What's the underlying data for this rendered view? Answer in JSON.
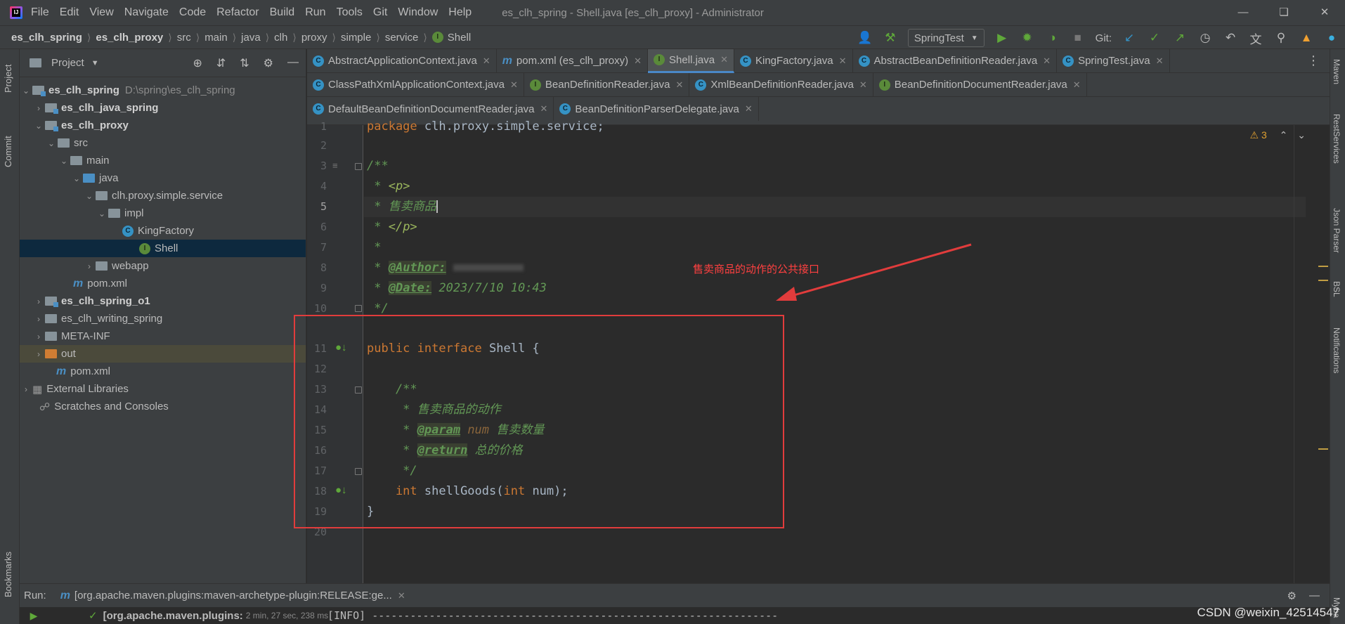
{
  "menubar": {
    "items": [
      "File",
      "Edit",
      "View",
      "Navigate",
      "Code",
      "Refactor",
      "Build",
      "Run",
      "Tools",
      "Git",
      "Window",
      "Help"
    ],
    "title": "es_clh_spring - Shell.java [es_clh_proxy] - Administrator"
  },
  "breadcrumb": [
    "es_clh_spring",
    "es_clh_proxy",
    "src",
    "main",
    "java",
    "clh",
    "proxy",
    "simple",
    "service",
    "Shell"
  ],
  "toolbar": {
    "run_config": "SpringTest",
    "git_label": "Git:"
  },
  "stripes": {
    "left": [
      "Project",
      "Commit",
      "Bookmarks"
    ],
    "right": [
      "Maven",
      "RestServices",
      "Json Parser",
      "BSL",
      "Notifications",
      "Myba"
    ]
  },
  "project": {
    "title": "Project",
    "tree": [
      {
        "label": "es_clh_spring",
        "extra": "D:\\spring\\es_clh_spring",
        "bold": true
      },
      {
        "label": "es_clh_java_spring",
        "bold": true
      },
      {
        "label": "es_clh_proxy",
        "bold": true
      },
      {
        "label": "src"
      },
      {
        "label": "main"
      },
      {
        "label": "java"
      },
      {
        "label": "clh.proxy.simple.service"
      },
      {
        "label": "impl"
      },
      {
        "label": "KingFactory"
      },
      {
        "label": "Shell"
      },
      {
        "label": "webapp"
      },
      {
        "label": "pom.xml"
      },
      {
        "label": "es_clh_spring_o1",
        "bold": true
      },
      {
        "label": "es_clh_writing_spring"
      },
      {
        "label": "META-INF"
      },
      {
        "label": "out"
      },
      {
        "label": "pom.xml"
      },
      {
        "label": "External Libraries"
      },
      {
        "label": "Scratches and Consoles"
      }
    ]
  },
  "tabs": {
    "row1": [
      "AbstractApplicationContext.java",
      "pom.xml (es_clh_proxy)",
      "Shell.java",
      "KingFactory.java",
      "AbstractBeanDefinitionReader.java",
      "SpringTest.java"
    ],
    "row2": [
      "ClassPathXmlApplicationContext.java",
      "BeanDefinitionReader.java",
      "XmlBeanDefinitionReader.java",
      "BeanDefinitionDocumentReader.java"
    ],
    "row3": [
      "DefaultBeanDefinitionDocumentReader.java",
      "BeanDefinitionParserDelegate.java"
    ]
  },
  "editor": {
    "line_numbers": [
      "1",
      "2",
      "3",
      "4",
      "5",
      "6",
      "7",
      "8",
      "9",
      "10",
      "11",
      "12",
      "13",
      "14",
      "15",
      "16",
      "17",
      "18",
      "19",
      "20"
    ],
    "warnings": "3",
    "code": {
      "l1_kw": "package",
      "l1_rest": " clh.proxy.simple.service;",
      "l3": "/**",
      "l4_star": " * ",
      "l4_tag": "<p>",
      "l5_star": " * ",
      "l5_text": "售卖商品",
      "l6_star": " * ",
      "l6_tag": "</p>",
      "l7": " *",
      "l8_star": " * ",
      "l8_ann": "@Author:",
      "l9_star": " * ",
      "l9_ann": "@Date:",
      "l9_val": " 2023/7/10 10:43",
      "l10": " */",
      "l11_kw": "public interface",
      "l11_name": " Shell {",
      "l13": "    /**",
      "l14": "     * 售卖商品的动作",
      "l15_star": "     * ",
      "l15_ann": "@param",
      "l15_pname": " num",
      "l15_desc": " 售卖数量",
      "l16_star": "     * ",
      "l16_ann": "@return",
      "l16_desc": " 总的价格",
      "l17": "     */",
      "l18_kw1": "    int",
      "l18_name": " shellGoods(",
      "l18_kw2": "int",
      "l18_rest": " num);",
      "l19": "}"
    }
  },
  "annotation": {
    "text": "售卖商品的动作的公共接口"
  },
  "run": {
    "label": "Run:",
    "tab": "[org.apache.maven.plugins:maven-archetype-plugin:RELEASE:ge...",
    "task": "[org.apache.maven.plugins:",
    "time": "2 min, 27 sec, 238 ms",
    "log": "[INFO] ----------------------------------------------------------------"
  },
  "watermark": "CSDN @weixin_42514547",
  "colors": {
    "accent": "#4a88c7",
    "annotation_red": "#e13c3c"
  }
}
